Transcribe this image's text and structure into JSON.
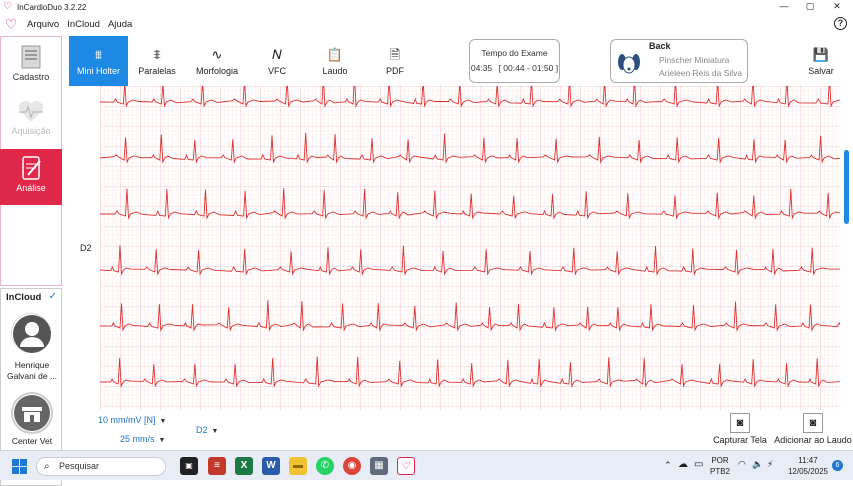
{
  "window": {
    "title": "InCardioDuo 3.2.22",
    "controls": {
      "minimize": "—",
      "maximize": "▢",
      "close": "✕"
    }
  },
  "menu": {
    "items": [
      "Arquivo",
      "InCloud",
      "Ajuda"
    ],
    "help": "?"
  },
  "sidebar": {
    "cadastro": "Cadastro",
    "aquisicao": "Aquisição",
    "analise": "Análise",
    "incloud_title": "InCloud",
    "incloud_check": "✓",
    "user_name_line1": "Henrique",
    "user_name_line2": "Galvani de ...",
    "clinic_name": "Center Vet"
  },
  "toolbar": {
    "tabs": [
      "Mini Holter",
      "Paralelas",
      "Morfologia",
      "VFC",
      "Laudo",
      "PDF"
    ],
    "active_tab": "Mini Holter",
    "save": "Salvar"
  },
  "exam": {
    "title": "Tempo do Exame",
    "elapsed": "04:35",
    "window": "[ 00:44 - 01:50 ]"
  },
  "patient": {
    "name": "Back",
    "breed": "Pinscher Miniatura",
    "owner": "Arieleen Reis da Silva"
  },
  "ecg": {
    "lead_label": "D2",
    "grid_color": "#f4b6b6",
    "trace_color": "#e03030"
  },
  "controls": {
    "gain": "10 mm/mV [N]",
    "speed": "25 mm/s",
    "lead_select": "D2",
    "capture": "Capturar Tela",
    "add_report": "Adicionar ao Laudo"
  },
  "taskbar": {
    "search": "Pesquisar",
    "lang_line1": "POR",
    "lang_line2": "PTB2",
    "time": "11:47",
    "date": "12/05/2025",
    "notifications": "6"
  }
}
